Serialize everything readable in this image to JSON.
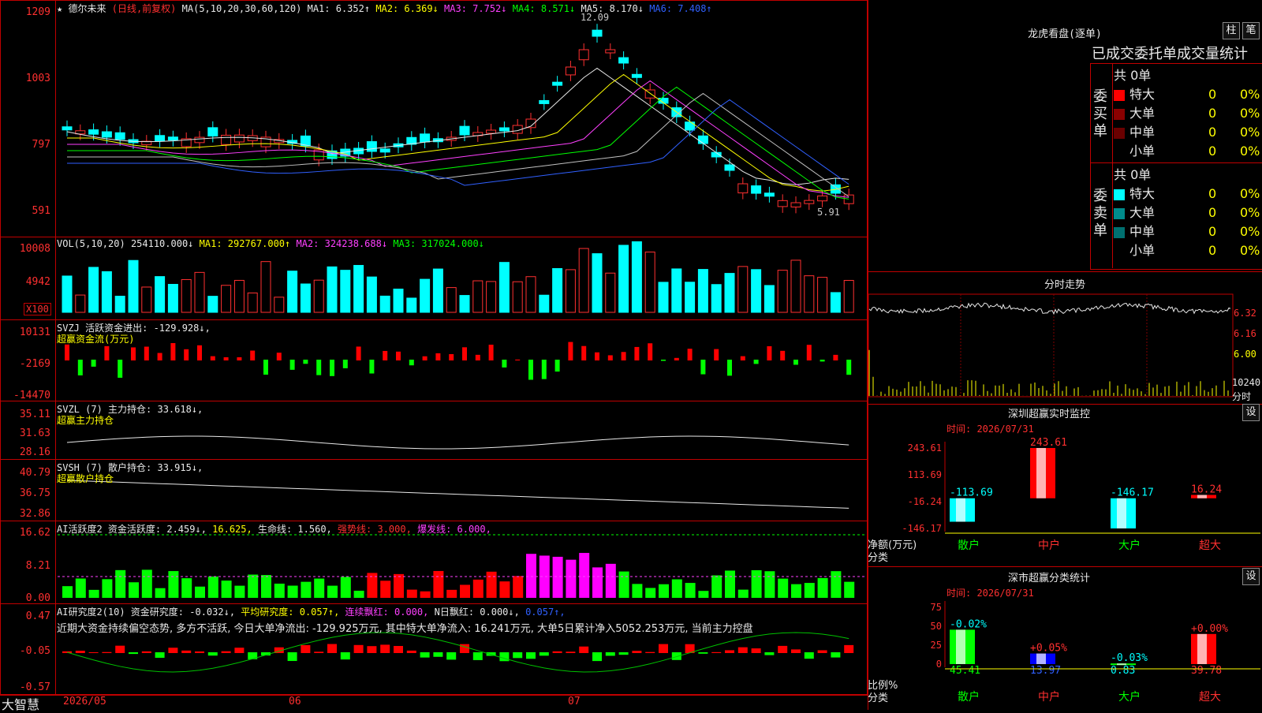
{
  "brand": "大智慧",
  "stock_header": {
    "star": "★",
    "name": "德尔未来",
    "mode": "(日线,前复权)",
    "ma_def": "MA(5,10,20,30,60,120)",
    "ma1": "MA1: 6.352↑",
    "ma2": "MA2: 6.369↓",
    "ma3": "MA3: 7.752↓",
    "ma4": "MA4: 8.571↓",
    "ma5": "MA5: 8.170↓",
    "ma6": "MA6: 7.408↑"
  },
  "price_axis": [
    "1209",
    "1003",
    "797",
    "591"
  ],
  "price_marks": {
    "high": "12.09",
    "low": "5.91"
  },
  "vol": {
    "def": "VOL(5,10,20)",
    "v": "254110.000↓",
    "ma1": "MA1: 292767.000↑",
    "ma2": "MA2: 324238.688↓",
    "ma3": "MA3: 317024.000↓",
    "axis": [
      "10008",
      "4942"
    ],
    "unit": "X100"
  },
  "svzj": {
    "line1": "SVZJ  活跃资金进出: -129.928↓,",
    "line2": "超赢资金流(万元)",
    "axis": [
      "10131",
      "-2169",
      "-14470"
    ]
  },
  "svzl": {
    "line1": "SVZL (7) 主力持仓: 33.618↓,",
    "line2": "超赢主力持仓",
    "axis": [
      "35.11",
      "31.63",
      "28.16"
    ]
  },
  "svsh": {
    "line1": "SVSH (7) 散户持仓: 33.915↓,",
    "line2": "超赢散户持仓",
    "axis": [
      "40.79",
      "36.75",
      "32.86"
    ]
  },
  "ai_active": {
    "a": "AI活跃度2 资金活跃度: 2.459↓,",
    "b": "16.625,",
    "c": "生命线: 1.560,",
    "d": "强势线: 3.000,",
    "e": "爆发线: 6.000,",
    "axis": [
      "16.62",
      "8.21",
      "0.00"
    ]
  },
  "ai_research": {
    "a": "AI研究度2(10) 资金研究度: -0.032↓,",
    "b": "平均研究度: 0.057↑,",
    "c": "连续飘红: 0.000,",
    "d": "N日飘红: 0.000↓,",
    "e": "0.057↑,",
    "text": "近期大资金持续偏空态势, 多方不活跃, 今日大单净流出: -129.925万元, 其中特大单净流入: 16.241万元, 大单5日累计净入5052.253万元, 当前主力控盘",
    "axis": [
      "0.47",
      "-0.05",
      "-0.57"
    ]
  },
  "date_axis": [
    "2026/05",
    "06",
    "07"
  ],
  "lhb": {
    "title": "龙虎看盘(逐单)",
    "btn1": "柱",
    "btn2": "笔",
    "tabs": "已成交委托单成交量统计",
    "buy_side": "委买单",
    "sell_side": "委卖单",
    "buy_total": "共 0单",
    "sell_total": "共 0单",
    "rows": [
      "特大",
      "大单",
      "中单",
      "小单"
    ],
    "count": "0",
    "pct": "0%"
  },
  "minute": {
    "title": "分时走势",
    "axis": [
      "6.32",
      "6.16",
      "6.00"
    ],
    "vol_axis": "10240",
    "vol_unit": "分时"
  },
  "sz_monitor": {
    "title": "深圳超赢实时监控",
    "btn": "设",
    "time": "时间: 2026/07/31",
    "axis": [
      "243.61",
      "113.69",
      "-16.24",
      "-146.17"
    ],
    "ylabel1": "净额(万元)",
    "ylabel2": "分类",
    "categories": [
      "散户",
      "中户",
      "大户",
      "超大"
    ],
    "labels": [
      "-113.69",
      "243.61",
      "-146.17",
      "16.24"
    ]
  },
  "sz_stats": {
    "title": "深市超赢分类统计",
    "btn": "设",
    "time": "时间: 2026/07/31",
    "axis": [
      "75",
      "50",
      "25",
      "0"
    ],
    "ylabel1": "比例%",
    "ylabel2": "分类",
    "categories": [
      "散户",
      "中户",
      "大户",
      "超大"
    ],
    "tops": [
      "-0.02%",
      "+0.05%",
      "-0.03%",
      "+0.00%"
    ],
    "bottoms": [
      "45.41",
      "13.97",
      "0.83",
      "39.78"
    ]
  },
  "chart_data": [
    {
      "type": "bar",
      "title": "深圳超赢实时监控",
      "ylabel": "净额(万元)",
      "xlabel": "分类",
      "categories": [
        "散户",
        "中户",
        "大户",
        "超大"
      ],
      "values": [
        -113.69,
        243.61,
        -146.17,
        16.24
      ],
      "ylim": [
        -146.17,
        243.61
      ]
    },
    {
      "type": "bar",
      "title": "深市超赢分类统计",
      "ylabel": "比例%",
      "xlabel": "分类",
      "categories": [
        "散户",
        "中户",
        "大户",
        "超大"
      ],
      "values": [
        45.41,
        13.97,
        0.83,
        39.78
      ],
      "ylim": [
        0,
        75
      ]
    }
  ]
}
